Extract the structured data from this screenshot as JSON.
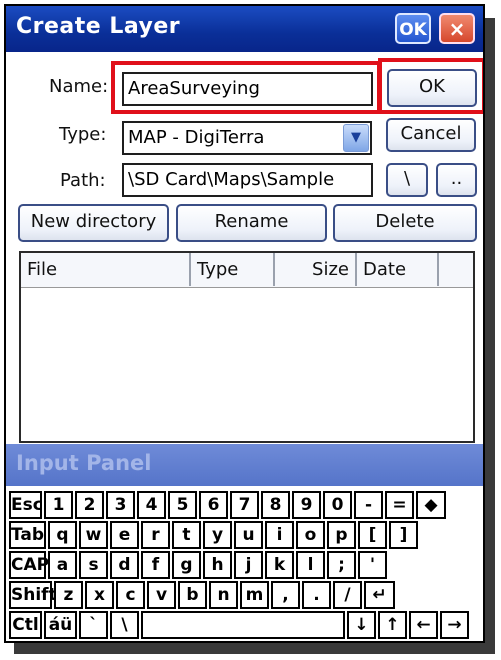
{
  "window": {
    "title": "Create Layer",
    "title_ok": "OK",
    "title_close": "×"
  },
  "form": {
    "name_label": "Name:",
    "name_value": "AreaSurveying",
    "type_label": "Type:",
    "type_value": "MAP - DigiTerra",
    "path_label": "Path:",
    "path_value": "\\SD Card\\Maps\\Sample"
  },
  "buttons": {
    "ok": "OK",
    "cancel": "Cancel",
    "root": "\\",
    "up": "..",
    "new_directory": "New directory",
    "rename": "Rename",
    "delete": "Delete"
  },
  "file_list": {
    "columns": [
      "File",
      "Type",
      "Size",
      "Date"
    ],
    "rows": []
  },
  "input_panel": {
    "title": "Input Panel"
  },
  "keyboard": {
    "row1": [
      "Esc",
      "1",
      "2",
      "3",
      "4",
      "5",
      "6",
      "7",
      "8",
      "9",
      "0",
      "-",
      "=",
      "◆"
    ],
    "row2": [
      "Tab",
      "q",
      "w",
      "e",
      "r",
      "t",
      "y",
      "u",
      "i",
      "o",
      "p",
      "[",
      "]"
    ],
    "row3": [
      "CAP",
      "a",
      "s",
      "d",
      "f",
      "g",
      "h",
      "j",
      "k",
      "l",
      ";",
      "'"
    ],
    "row4": [
      "Shift",
      "z",
      "x",
      "c",
      "v",
      "b",
      "n",
      "m",
      ",",
      ".",
      "/",
      "↵"
    ],
    "row5": [
      "Ctl",
      "áü",
      "`",
      "\\",
      "↓",
      "↑",
      "←",
      "→"
    ]
  }
}
